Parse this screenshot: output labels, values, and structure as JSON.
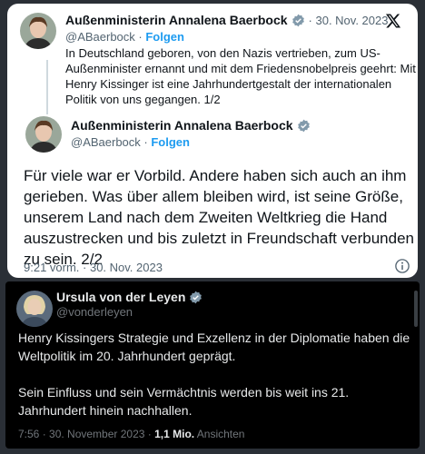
{
  "tweet_card": {
    "first_tweet": {
      "author_name": "Außenministerin Annalena Baerbock",
      "date": "· 30. Nov. 2023",
      "handle": "@ABaerbock",
      "follow_label": "Folgen",
      "separator": " · ",
      "text": "In Deutschland geboren, von den Nazis vertrieben, zum US-Außenminister ernannt und mit dem Friedensnobelpreis geehrt: Mit Henry Kissinger ist eine Jahrhundertgestalt der internationalen Politik von uns gegangen. 1/2"
    },
    "second_tweet": {
      "author_name": "Außenministerin Annalena Baerbock",
      "handle": "@ABaerbock",
      "follow_label": "Folgen",
      "separator": " · ",
      "text": "Für viele war er Vorbild. Andere haben sich auch an ihm gerieben. Was über allem bleiben wird, ist seine Größe, unserem Land nach dem Zweiten Weltkrieg die Hand auszustrecken und bis zuletzt in Freundschaft verbunden zu sein. 2/2",
      "timestamp": "9:21 vorm. · 30. Nov. 2023"
    },
    "brand_icon": "x-logo-icon",
    "accent_color": "#1d9bf0"
  },
  "dark_card": {
    "author_name": "Ursula von der Leyen",
    "handle": "@vonderleyen",
    "paragraphs": [
      "Henry Kissingers Strategie und Exzellenz in der Diplomatie haben die Weltpolitik im 20. Jahrhundert geprägt.",
      "Sein Einfluss und sein Vermächtnis werden bis weit ins 21. Jahrhundert hinein nachhallen."
    ],
    "timestamp": "7:56 · 30. November 2023 · ",
    "views_count": "1,1 Mio.",
    "views_label": " Ansichten"
  }
}
